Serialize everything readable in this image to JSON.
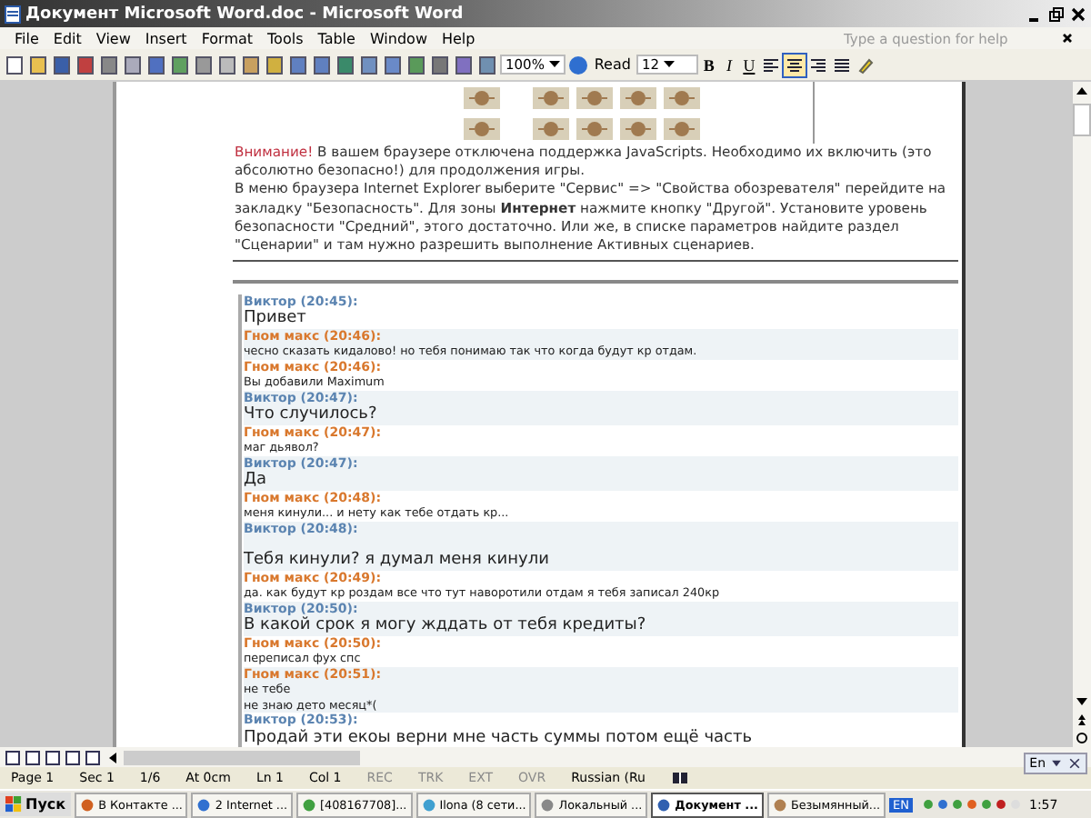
{
  "window": {
    "title": "Документ Microsoft Word.doc - Microsoft Word"
  },
  "menu": [
    "File",
    "Edit",
    "View",
    "Insert",
    "Format",
    "Tools",
    "Table",
    "Window",
    "Help"
  ],
  "help_box": {
    "placeholder": "Type a question for help"
  },
  "toolbar": {
    "zoom": "100%",
    "read": "Read",
    "font_size": "12",
    "format_buttons": [
      {
        "label": "B",
        "selected": false
      },
      {
        "label": "I",
        "selected": false
      },
      {
        "label": "U",
        "selected": false
      }
    ],
    "alignment": [
      {
        "selected": false
      },
      {
        "selected": true
      },
      {
        "selected": false
      },
      {
        "selected": false
      }
    ]
  },
  "document": {
    "warning": {
      "label": "Внимание!",
      "text": " В вашем браузере отключена поддержка JavaScripts. Необходимо их включить (это абсолютно безопасно!) для продолжения игры."
    },
    "instructions": "В меню браузера Internet Explorer выберите \"Сервис\" => \"Свойства обозревателя\" перейдите на закладку \"Безопасность\". Для зоны **Интернет** нажмите кнопку \"Другой\". Установите уровень безопасности \"Средний\", этого достаточно. Или же, в списке параметров найдите раздел \"Сценарии\" и там нужно разрешить выполнение Активных сценариев.",
    "chat": [
      {
        "author": "Виктор (20:45):",
        "color": "#5b84b1",
        "kind": "large",
        "lines": [
          "Привет"
        ]
      },
      {
        "author": "Гном макс (20:46):",
        "color": "#d9782d",
        "kind": "small",
        "lines": [
          "чесно сказать кидалово! но тебя понимаю так что когда будут кр отдам."
        ]
      },
      {
        "author": "Гном макс (20:46):",
        "color": "#d9782d",
        "kind": "small",
        "lines": [
          "Вы добавили Maximum"
        ]
      },
      {
        "author": "Виктор (20:47):",
        "color": "#5b84b1",
        "kind": "large",
        "lines": [
          "Что случилось?"
        ]
      },
      {
        "author": "Гном макс (20:47):",
        "color": "#d9782d",
        "kind": "small",
        "lines": [
          "маг дьявол?"
        ]
      },
      {
        "author": "Виктор (20:47):",
        "color": "#5b84b1",
        "kind": "large",
        "lines": [
          "Да"
        ]
      },
      {
        "author": "Гном макс (20:48):",
        "color": "#d9782d",
        "kind": "small",
        "lines": [
          "меня кинули... и нету как тебе отдать кр..."
        ]
      },
      {
        "author": "Виктор (20:48):",
        "color": "#5b84b1",
        "kind": "spaced",
        "lines": [
          "Тебя кинули? я думал меня кинули"
        ]
      },
      {
        "author": "Гном макс (20:49):",
        "color": "#d9782d",
        "kind": "small",
        "lines": [
          "да. как будут кр роздам все что тут наворотили отдам я тебя записал 240кр"
        ]
      },
      {
        "author": "Виктор (20:50):",
        "color": "#5b84b1",
        "kind": "large",
        "lines": [
          "В какой срок я могу жддать от тебя кредиты?"
        ]
      },
      {
        "author": "Гном макс (20:50):",
        "color": "#d9782d",
        "kind": "small",
        "lines": [
          "переписал фух спс"
        ]
      },
      {
        "author": "Гном макс (20:51):",
        "color": "#d9782d",
        "kind": "small",
        "lines": [
          "не тебе",
          "не знаю дето месяц*("
        ]
      },
      {
        "author": "Виктор (20:53):",
        "color": "#5b84b1",
        "kind": "large",
        "lines": [
          "Продай эти екоы верни мне часть суммы потом ещё часть"
        ]
      }
    ]
  },
  "language_bar": {
    "label": "En"
  },
  "status_bar": [
    {
      "label": "Page 1",
      "disabled": false
    },
    {
      "label": "Sec 1",
      "disabled": false
    },
    {
      "label": "1/6",
      "disabled": false
    },
    {
      "label": "At 0cm",
      "disabled": false
    },
    {
      "label": "Ln 1",
      "disabled": false
    },
    {
      "label": "Col 1",
      "disabled": false
    },
    {
      "label": "REC",
      "disabled": true
    },
    {
      "label": "TRK",
      "disabled": true
    },
    {
      "label": "EXT",
      "disabled": true
    },
    {
      "label": "OVR",
      "disabled": true
    },
    {
      "label": "Russian (Ru",
      "disabled": false
    }
  ],
  "taskbar": {
    "start": "Пуск",
    "tasks": [
      {
        "label": "В Контакте ...",
        "selected": false
      },
      {
        "label": "2 Internet ...",
        "selected": false
      },
      {
        "label": "[408167708]...",
        "selected": false
      },
      {
        "label": "Ilona (8 сети...",
        "selected": false
      },
      {
        "label": "Локальный ...",
        "selected": false
      },
      {
        "label": "Документ ...",
        "selected": true
      },
      {
        "label": "Безымянный...",
        "selected": false
      }
    ],
    "language": "EN",
    "clock": "1:57"
  }
}
